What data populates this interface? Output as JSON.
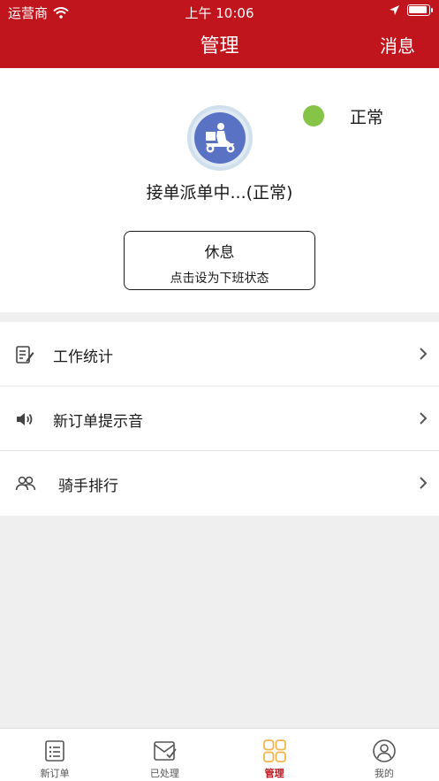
{
  "status_bar": {
    "carrier": "运营商",
    "time": "上午 10:06"
  },
  "nav": {
    "title": "管理",
    "right_action": "消息"
  },
  "profile": {
    "status_label": "正常",
    "status_color": "#86c448",
    "dispatch_text": "接单派单中...(正常)",
    "rest_button": {
      "title": "休息",
      "subtitle": "点击设为下班状态"
    }
  },
  "menu": {
    "items": [
      {
        "label": "工作统计",
        "icon": "edit-list-icon"
      },
      {
        "label": "新订单提示音",
        "icon": "speaker-icon"
      },
      {
        "label": "骑手排行",
        "icon": "users-icon"
      }
    ]
  },
  "tabbar": {
    "tabs": [
      {
        "label": "新订单",
        "icon": "list-icon",
        "active": false
      },
      {
        "label": "已处理",
        "icon": "processed-icon",
        "active": false
      },
      {
        "label": "管理",
        "icon": "grid-icon",
        "active": true
      },
      {
        "label": "我的",
        "icon": "user-icon",
        "active": false
      }
    ]
  },
  "colors": {
    "brand": "#c0151c",
    "active_tab_icon": "#f3b54a"
  }
}
